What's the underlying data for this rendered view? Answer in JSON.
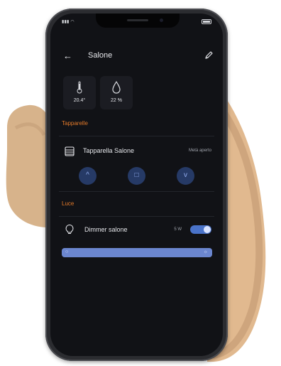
{
  "header": {
    "back_glyph": "←",
    "title": "Salone",
    "edit_icon": "pencil-icon"
  },
  "sensors": [
    {
      "icon": "thermometer-icon",
      "value": "20.4°"
    },
    {
      "icon": "drop-icon",
      "value": "22 %"
    }
  ],
  "sections": {
    "tapparelle": {
      "label": "Tapparelle",
      "device": {
        "icon": "blinds-icon",
        "name": "Tapparella Salone",
        "status": "Metà aperto",
        "controls": [
          {
            "icon": "chevron-up-icon",
            "glyph": "^"
          },
          {
            "icon": "stop-icon",
            "glyph": "□"
          },
          {
            "icon": "chevron-down-icon",
            "glyph": "v"
          }
        ]
      }
    },
    "luce": {
      "label": "Luce",
      "device": {
        "icon": "bulb-icon",
        "name": "Dimmer salone",
        "power": "5 W",
        "toggle_on": true
      }
    }
  }
}
